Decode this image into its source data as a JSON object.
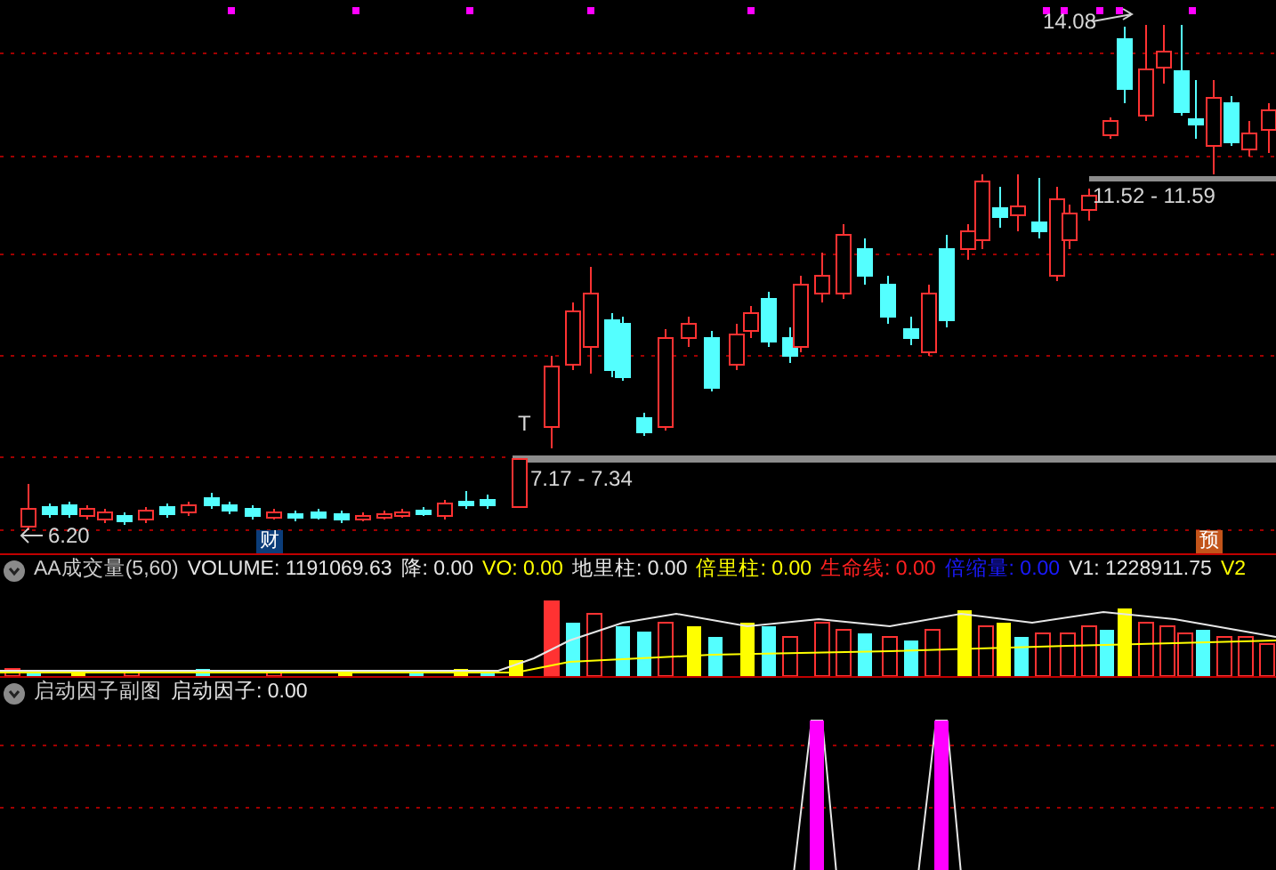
{
  "main_chart": {
    "annotations": [
      {
        "kind": "high",
        "text": "14.08"
      },
      {
        "kind": "range_upper",
        "text": "11.52 - 11.59"
      },
      {
        "kind": "signal",
        "text": "T"
      },
      {
        "kind": "range_lower",
        "text": "7.17 - 7.34"
      },
      {
        "kind": "low",
        "text": "6.20"
      }
    ],
    "badges": [
      {
        "text": "财",
        "color": "#0b3d7a"
      },
      {
        "text": "预",
        "color": "#c2541a"
      }
    ]
  },
  "volume_panel": {
    "title": "AA成交量(5,60)",
    "items": [
      {
        "text": "VOLUME: 1191069.63",
        "color": "#e6e6e6"
      },
      {
        "text": "降: 0.00",
        "color": "#e6e6e6"
      },
      {
        "text": "VO: 0.00",
        "color": "#ffff00"
      },
      {
        "text": "地里柱: 0.00",
        "color": "#e6e6e6"
      },
      {
        "text": "倍里柱: 0.00",
        "color": "#ffff00"
      },
      {
        "text": "生命线: 0.00",
        "color": "#ff2020"
      },
      {
        "text": "倍缩量: 0.00",
        "color": "#1a1aff"
      },
      {
        "text": "V1: 1228911.75",
        "color": "#e6e6e6"
      },
      {
        "text": "V2",
        "color": "#ffff00"
      }
    ]
  },
  "indicator_panel": {
    "title": "启动因子副图",
    "items": [
      {
        "text": "启动因子: 0.00",
        "color": "#e6e6e6"
      }
    ]
  }
}
